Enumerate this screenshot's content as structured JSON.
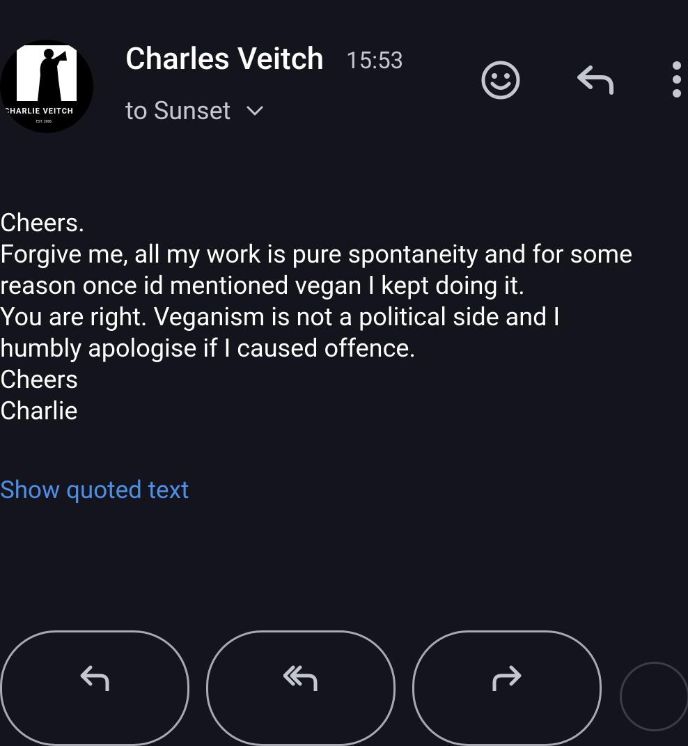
{
  "avatar": {
    "brand_text": "CHARLIE VEITCH",
    "est_text": "EST. 2006"
  },
  "header": {
    "sender": "Charles Veitch",
    "time": "15:53",
    "recipient": "to Sunset"
  },
  "body": {
    "lines": [
      "Cheers.",
      "Forgive me, all my work is pure spontaneity and for some",
      "reason once id mentioned vegan I kept doing it.",
      "You are right. Veganism is not a political side and I",
      "humbly apologise if I caused offence.",
      "Cheers",
      "Charlie"
    ],
    "show_quoted": "Show quoted text"
  },
  "icons": {
    "emoji": "smiley-icon",
    "reply": "reply-icon",
    "more": "more-vertical-icon",
    "reply_all": "reply-all-icon",
    "forward": "forward-icon"
  },
  "colors": {
    "background": "#14141d",
    "link": "#4f8ee6",
    "secondary_text": "#c4c7d0"
  }
}
